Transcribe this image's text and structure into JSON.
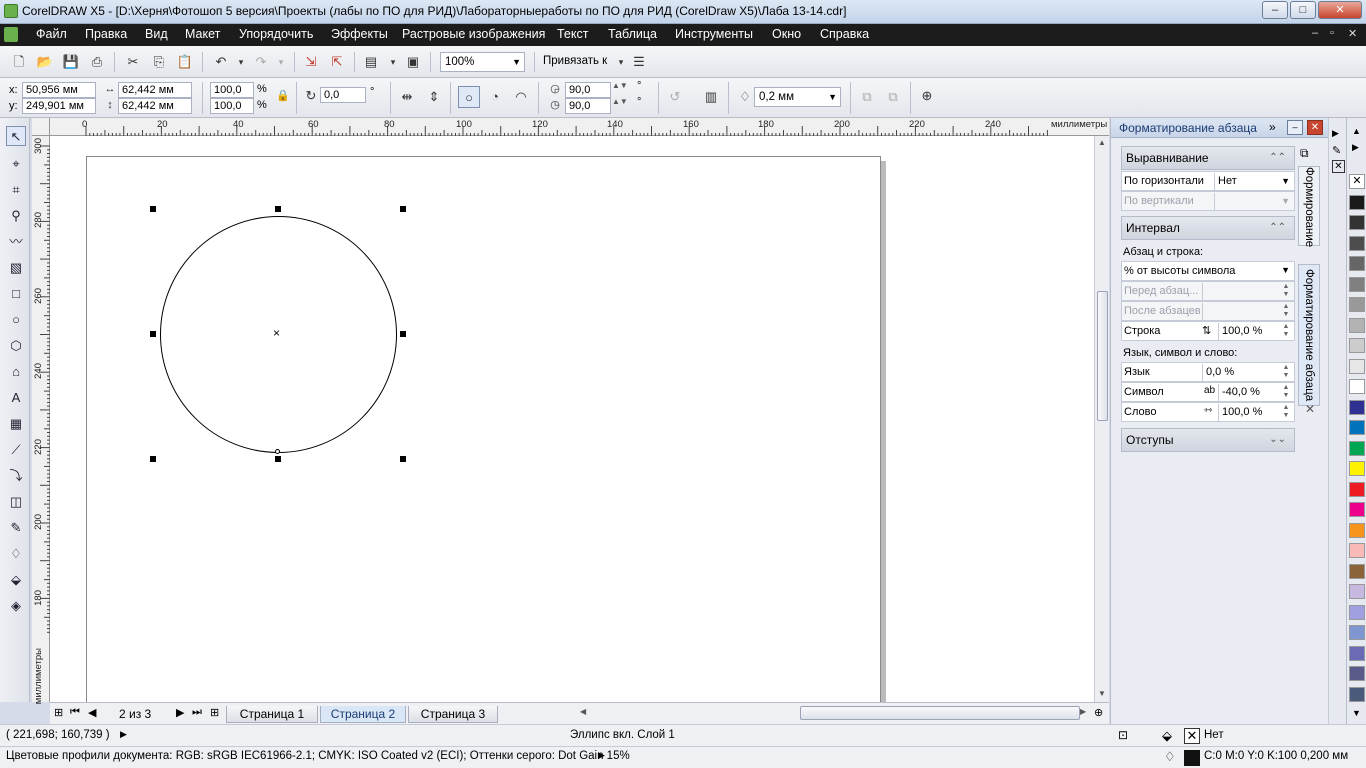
{
  "window": {
    "title": "CorelDRAW X5 - [D:\\Херня\\Фотошоп 5 версия\\Проекты (лабы по ПО для РИД)\\Лабораторныеработы по ПО для РИД (CorelDraw X5)\\Лаба 13-14.cdr]",
    "min": "–",
    "max": "□",
    "close": "✕"
  },
  "menu": [
    "Файл",
    "Правка",
    "Вид",
    "Макет",
    "Упорядочить",
    "Эффекты",
    "Растровые изображения",
    "Текст",
    "Таблица",
    "Инструменты",
    "Окно",
    "Справка"
  ],
  "mdi": {
    "min": "–",
    "restore": "▫",
    "close": "✕"
  },
  "toolbar": {
    "zoom": "100%",
    "snap": "Привязать к"
  },
  "property": {
    "x_label": "x:",
    "x": "50,956 мм",
    "y_label": "y:",
    "y": "249,901 мм",
    "w": "62,442 мм",
    "h": "62,442 мм",
    "sx": "100,0",
    "sy": "100,0",
    "pct": "%",
    "rot": "0,0",
    "deg": "°",
    "a1": "90,0",
    "a2": "90,0",
    "outline": "0,2 мм"
  },
  "ruler": {
    "unit": "миллиметры",
    "h": [
      "0",
      "20",
      "40",
      "60",
      "80",
      "100",
      "120",
      "140",
      "160",
      "180",
      "200",
      "220",
      "240"
    ],
    "v": [
      "300",
      "280",
      "260",
      "240",
      "220",
      "200",
      "180"
    ]
  },
  "pages": {
    "count": "2 из 3",
    "tabs": [
      "Страница 1",
      "Страница 2",
      "Страница 3"
    ],
    "active": 1
  },
  "status": {
    "coords": "( 221,698; 160,739 )",
    "object": "Эллипс вкл. Слой 1",
    "fill": "Нет",
    "profiles": "Цветовые профили документа: RGB: sRGB IEC61966-2.1; CMYK: ISO Coated v2 (ECI); Оттенки серого: Dot Gain 15%",
    "outline": "C:0 M:0 Y:0 K:100  0,200 мм"
  },
  "docker": {
    "title": "Форматирование абзаца",
    "align": {
      "header": "Выравнивание",
      "h_label": "По горизонтали",
      "h_value": "Нет",
      "v_label": "По вертикали"
    },
    "interval": {
      "header": "Интервал",
      "para_line": "Абзац и строка:",
      "mode": "% от высоты символа",
      "before": "Перед абзац...",
      "after": "После абзацев",
      "line_label": "Строка",
      "line_value": "100,0 %",
      "lang_sym_word": "Язык, символ и слово:",
      "lang_label": "Язык",
      "lang_value": "0,0 %",
      "sym_label": "Символ",
      "sym_value": "-40,0 %",
      "word_label": "Слово",
      "word_value": "100,0 %"
    },
    "indents": {
      "header": "Отступы"
    },
    "vtabs": [
      "Формирование",
      "Форматирование абзаца"
    ]
  },
  "palette": [
    "#ffffff",
    "#1a1a1a",
    "#333333",
    "#4d4d4d",
    "#666666",
    "#808080",
    "#999999",
    "#b3b3b3",
    "#cccccc",
    "#e6e6e6",
    "#ffffff",
    "#2e3192",
    "#0072bc",
    "#00a651",
    "#fff200",
    "#ed1c24",
    "#ec008c",
    "#f7941d",
    "#f9b9b7",
    "#8c6239",
    "#c7b8e0",
    "#a0a0e0",
    "#7f96d0",
    "#6b6bb5",
    "#5a5a8a",
    "#4a5a7a"
  ]
}
